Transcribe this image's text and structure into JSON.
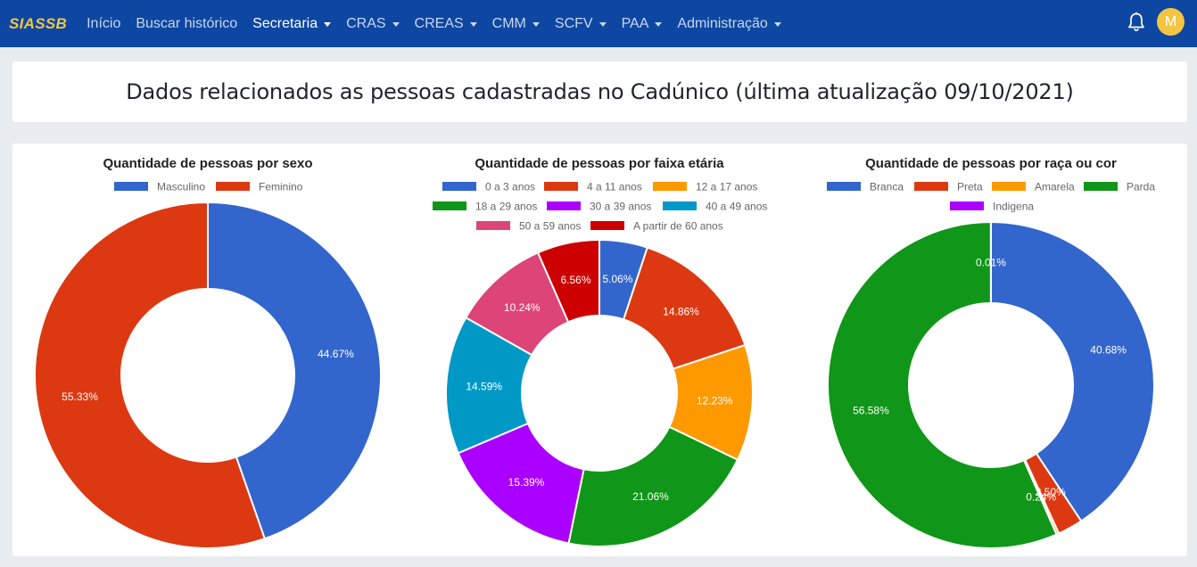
{
  "navbar": {
    "brand": "SIASSB",
    "items": [
      {
        "label": "Início",
        "dropdown": false,
        "active": false
      },
      {
        "label": "Buscar histórico",
        "dropdown": false,
        "active": false
      },
      {
        "label": "Secretaria",
        "dropdown": true,
        "active": true
      },
      {
        "label": "CRAS",
        "dropdown": true,
        "active": false
      },
      {
        "label": "CREAS",
        "dropdown": true,
        "active": false
      },
      {
        "label": "CMM",
        "dropdown": true,
        "active": false
      },
      {
        "label": "SCFV",
        "dropdown": true,
        "active": false
      },
      {
        "label": "PAA",
        "dropdown": true,
        "active": false
      },
      {
        "label": "Administração",
        "dropdown": true,
        "active": false
      }
    ],
    "avatar_letter": "M",
    "icons": {
      "notifications": "bell-icon"
    }
  },
  "page": {
    "title": "Dados relacionados as pessoas cadastradas no Cadúnico (última atualização 09/10/2021)"
  },
  "colors": {
    "navbar": "#0d47a1",
    "brand": "#f4c542",
    "avatar": "#f4c542"
  },
  "chart_data": [
    {
      "type": "pie",
      "variant": "doughnut",
      "title": "Quantidade de pessoas por sexo",
      "legend_position": "top",
      "categories": [
        "Masculino",
        "Feminino"
      ],
      "values": [
        44.67,
        55.33
      ],
      "labels": [
        "44.67%",
        "55.33%"
      ],
      "colors": [
        "#3366cc",
        "#dc3912"
      ]
    },
    {
      "type": "pie",
      "variant": "doughnut",
      "title": "Quantidade de pessoas por faixa etária",
      "legend_position": "top",
      "categories": [
        "0 a 3 anos",
        "4 a 11 anos",
        "12 a 17 anos",
        "18 a 29 anos",
        "30 a 39 anos",
        "40 a 49 anos",
        "50 a 59 anos",
        "A partir de 60 anos"
      ],
      "values": [
        5.06,
        14.86,
        12.23,
        21.06,
        15.39,
        14.59,
        10.24,
        6.56
      ],
      "labels": [
        "5.06%",
        "14.86%",
        "12.23%",
        "21.06%",
        "15.39%",
        "14.59%",
        "10.24%",
        "6.56%"
      ],
      "colors": [
        "#3366cc",
        "#dc3912",
        "#ff9900",
        "#109618",
        "#aa00ff",
        "#0099c6",
        "#dd4477",
        "#cc0000"
      ]
    },
    {
      "type": "pie",
      "variant": "doughnut",
      "title": "Quantidade de pessoas por raça ou cor",
      "legend_position": "top",
      "categories": [
        "Branca",
        "Preta",
        "Amarela",
        "Parda",
        "Indigena"
      ],
      "values": [
        40.68,
        2.5,
        0.24,
        56.58,
        0.01
      ],
      "labels": [
        "40.68%",
        "2.50%",
        "0.24%",
        "56.58%",
        "0.01%"
      ],
      "colors": [
        "#3366cc",
        "#dc3912",
        "#ff9900",
        "#109618",
        "#aa00ff"
      ]
    }
  ]
}
